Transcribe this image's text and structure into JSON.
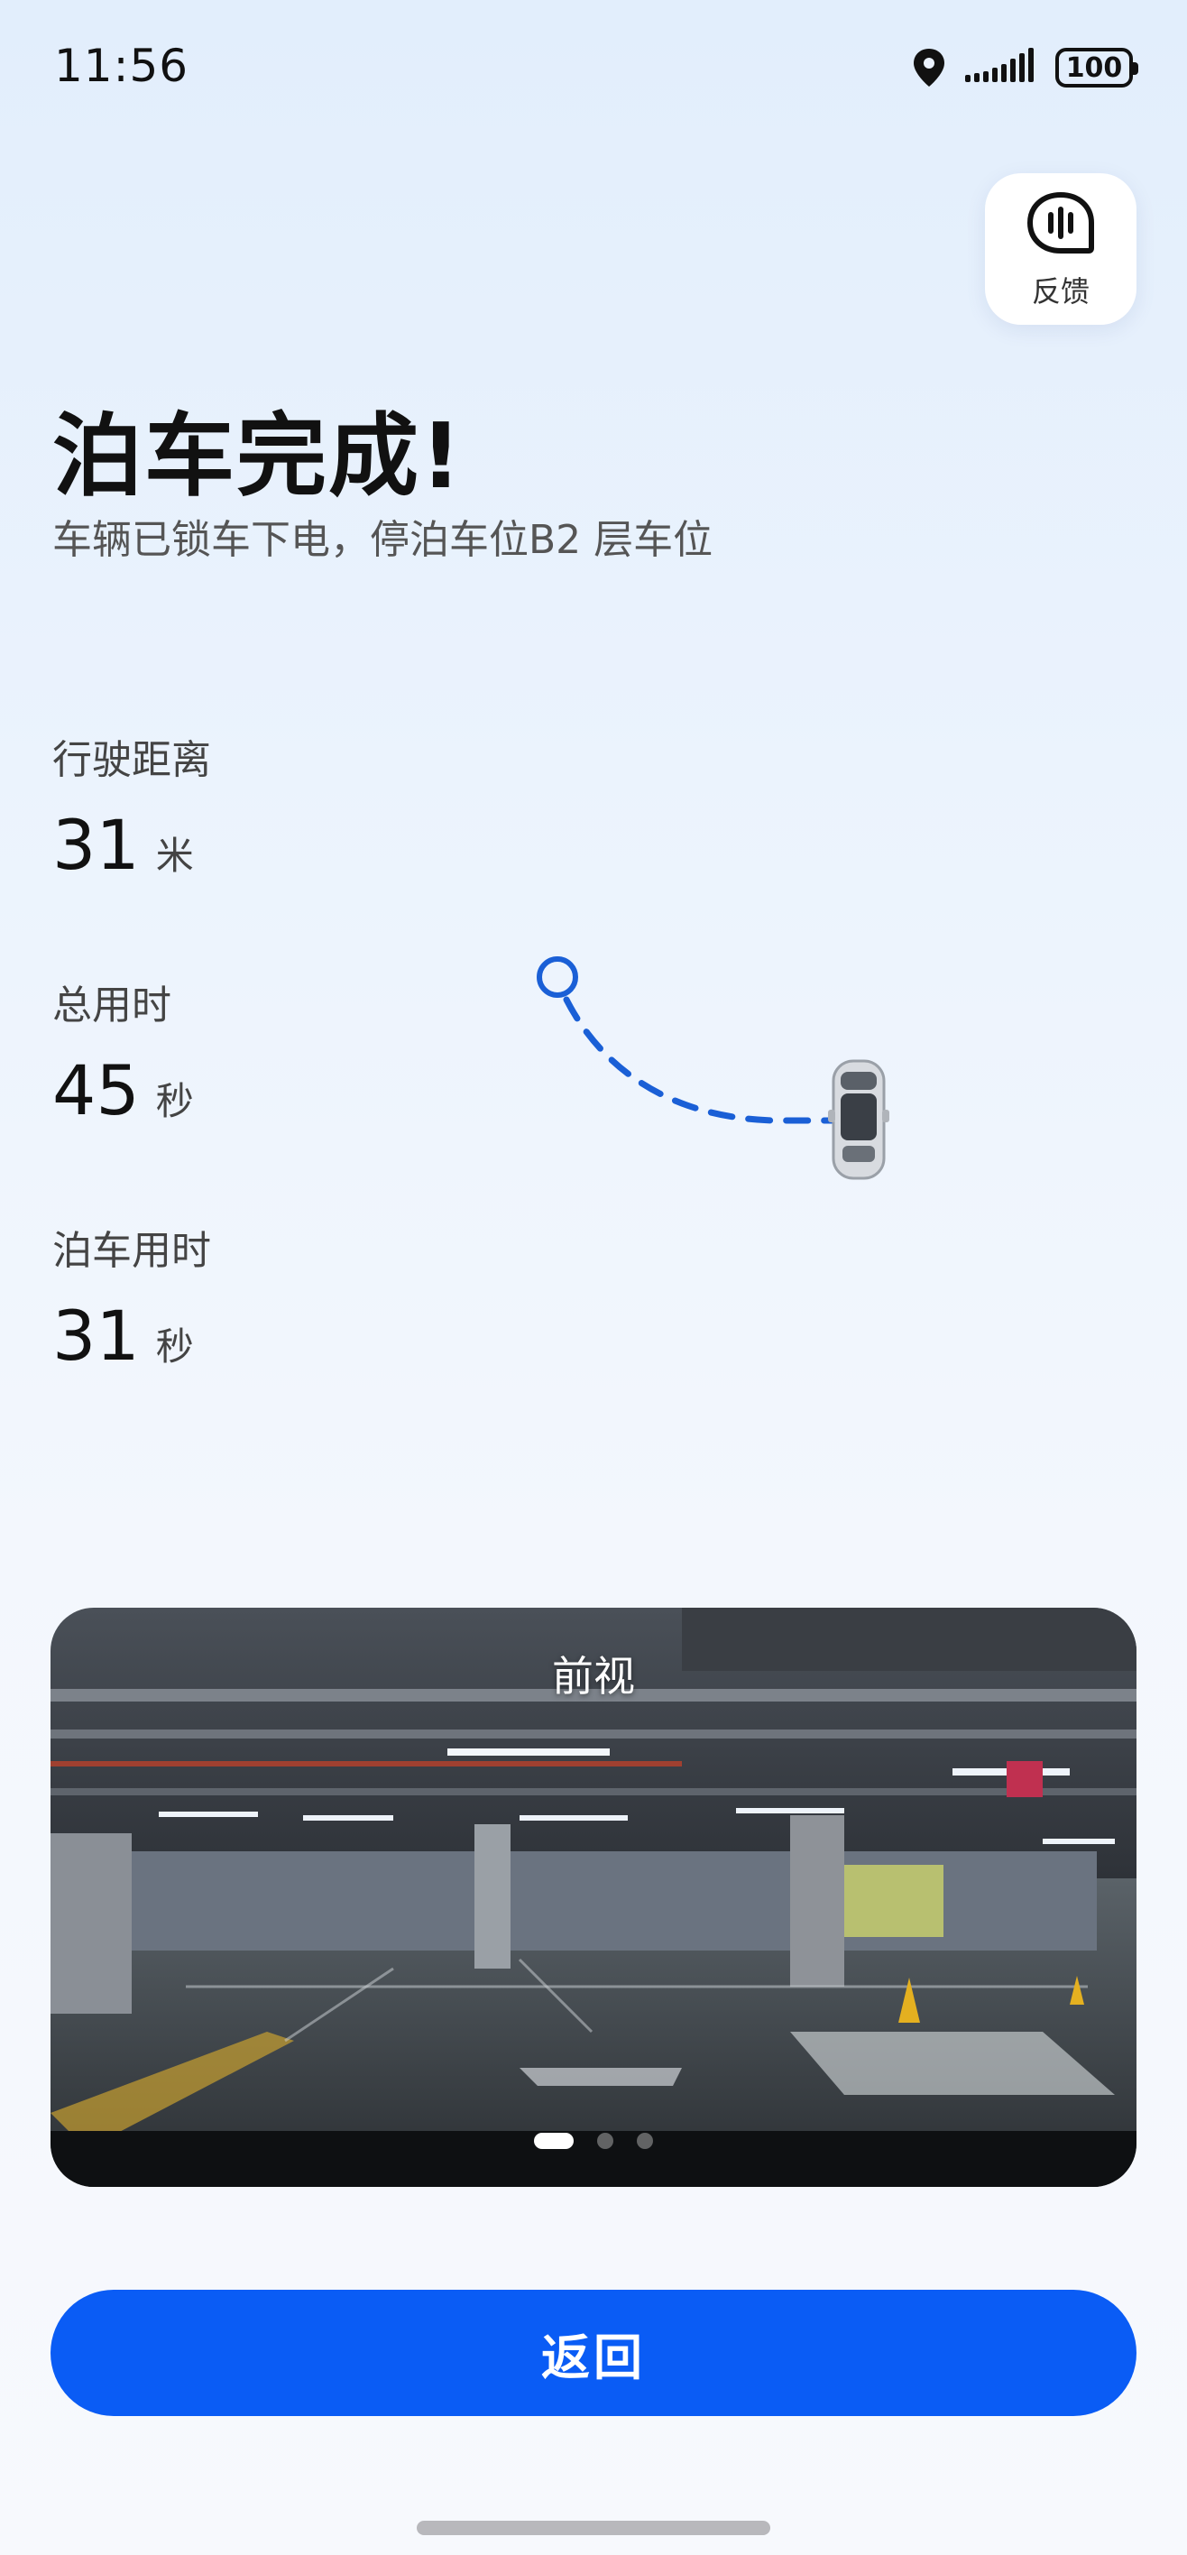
{
  "status_bar": {
    "time": "11:56",
    "battery": "100"
  },
  "feedback": {
    "label": "反馈",
    "icon": "voice-chat-icon"
  },
  "header": {
    "title": "泊车完成!",
    "subtitle": "车辆已锁车下电，停泊车位B2 层车位"
  },
  "stats": [
    {
      "label": "行驶距离",
      "value": "31",
      "unit": "米"
    },
    {
      "label": "总用时",
      "value": "45",
      "unit": "秒"
    },
    {
      "label": "泊车用时",
      "value": "31",
      "unit": "秒"
    }
  ],
  "camera": {
    "label": "前视",
    "page_count": 3,
    "active_page": 0
  },
  "actions": {
    "return_label": "返回"
  },
  "colors": {
    "primary": "#0a5cf5",
    "path": "#1a5fd6"
  }
}
